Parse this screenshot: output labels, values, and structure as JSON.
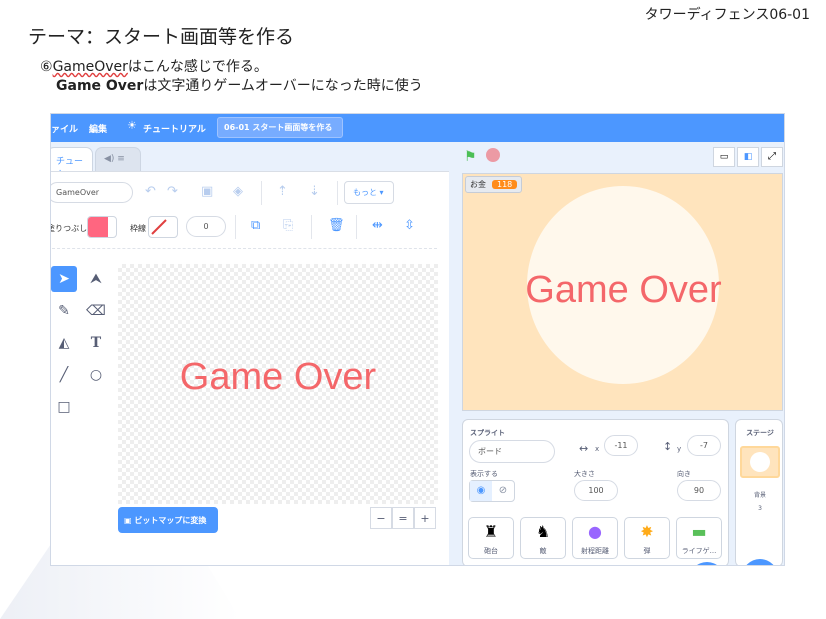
{
  "doc": {
    "title": "テーマ：スタート画面等を作る",
    "corner": "タワーディフェンス06-01",
    "line1_prefix": "⑥",
    "line1_underlined": "GameOver",
    "line1_rest": "はこんな感じで作る。",
    "line2_bold": "Game Over",
    "line2_rest": "は文字通りゲームオーバーになった時に使う"
  },
  "menubar": {
    "file": "ァイル",
    "edit": "編集",
    "tutorial": "チュートリアル",
    "project_name": "06-01 スタート画面等を作る"
  },
  "tabs": {
    "costumes": "チューム",
    "sounds": "◀) ≡"
  },
  "paint": {
    "costume_name": "GameOver",
    "more": "もっと ▾",
    "fill_label": "塗りつぶし",
    "outline_label": "枠線",
    "outline_width": "0",
    "canvas_text": "Game Over",
    "bitmap_button": "ビットマップに変換",
    "zoom_out": "−",
    "zoom_reset": "=",
    "zoom_in": "+",
    "fill_color": "#ff6680"
  },
  "stage": {
    "monitor_label": "お金",
    "monitor_value": "118",
    "text": "Game Over"
  },
  "sprite_info": {
    "sprite_label": "スプライト",
    "sprite_name": "ボード",
    "x_label": "x",
    "x_value": "-11",
    "y_label": "y",
    "y_value": "-7",
    "show_label": "表示する",
    "size_label": "大きさ",
    "size_value": "100",
    "direction_label": "向き",
    "direction_value": "90"
  },
  "sprites": [
    {
      "name": "砲台"
    },
    {
      "name": "敵"
    },
    {
      "name": "射程距離"
    },
    {
      "name": "弾"
    },
    {
      "name": "ライフゲ..."
    }
  ],
  "stage_panel": {
    "title": "ステージ",
    "backdrops_label": "背景",
    "backdrops_count": "3"
  }
}
